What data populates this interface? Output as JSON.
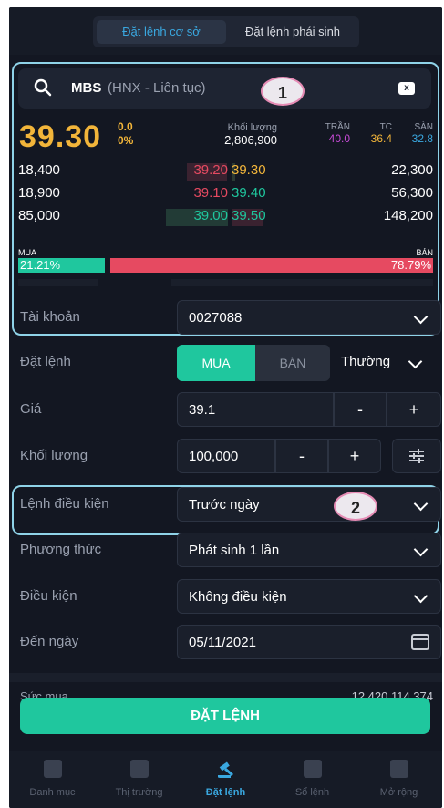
{
  "tabs": [
    "Đặt lệnh cơ sở",
    "Đặt lệnh phái sinh"
  ],
  "search": {
    "symbol": "MBS",
    "exchange": "(HNX - Liên tục)",
    "clear_icon": "x"
  },
  "markers": [
    "1",
    "2"
  ],
  "quote": {
    "price": "39.30",
    "change": "0.0",
    "change_pct": "0%",
    "volume_label": "Khối lượng",
    "volume": "2,806,900",
    "ceiling_label": "TRẦN",
    "ceiling": "40.0",
    "ref_label": "TC",
    "ref": "36.4",
    "floor_label": "SÀN",
    "floor": "32.8"
  },
  "orderbook": [
    {
      "bid_vol": "18,400",
      "bid": "39.20",
      "ask": "39.30",
      "ask_vol": "22,300"
    },
    {
      "bid_vol": "18,900",
      "bid": "39.10",
      "ask": "39.40",
      "ask_vol": "56,300"
    },
    {
      "bid_vol": "85,000",
      "bid": "39.00",
      "ask": "39.50",
      "ask_vol": "148,200"
    }
  ],
  "ratio": {
    "buy_label": "MUA",
    "buy_pct": "21.21%",
    "sell_label": "BÁN",
    "sell_pct": "78.79%",
    "buy_fraction": 0.2121
  },
  "form": {
    "account_label": "Tài khoản",
    "account": "0027088",
    "order_label": "Đặt lệnh",
    "buy": "MUA",
    "sell": "BÁN",
    "order_type": "Thường",
    "price_label": "Giá",
    "price": "39.1",
    "minus": "-",
    "plus": "+",
    "qty_label": "Khối lượng",
    "qty": "100,000",
    "cond_order_label": "Lệnh điều kiện",
    "cond_order": "Trước ngày",
    "method_label": "Phương thức",
    "method": "Phát sinh 1 lần",
    "condition_label": "Điều kiện",
    "condition": "Không điều kiện",
    "to_date_label": "Đến ngày",
    "to_date": "05/11/2021"
  },
  "buying_power": {
    "label": "Sức mua",
    "value": "12,420,114,374"
  },
  "submit": "ĐẶT LỆNH",
  "nav": [
    "Danh mục",
    "Thị trường",
    "Đặt lệnh",
    "Sổ lệnh",
    "Mở rộng"
  ],
  "colors": {
    "bg": "#131722",
    "accent": "#1fc79e",
    "sell": "#e64a61",
    "price": "#f2b53a",
    "ceiling": "#c84bd8",
    "floor": "#3aa8e0"
  }
}
